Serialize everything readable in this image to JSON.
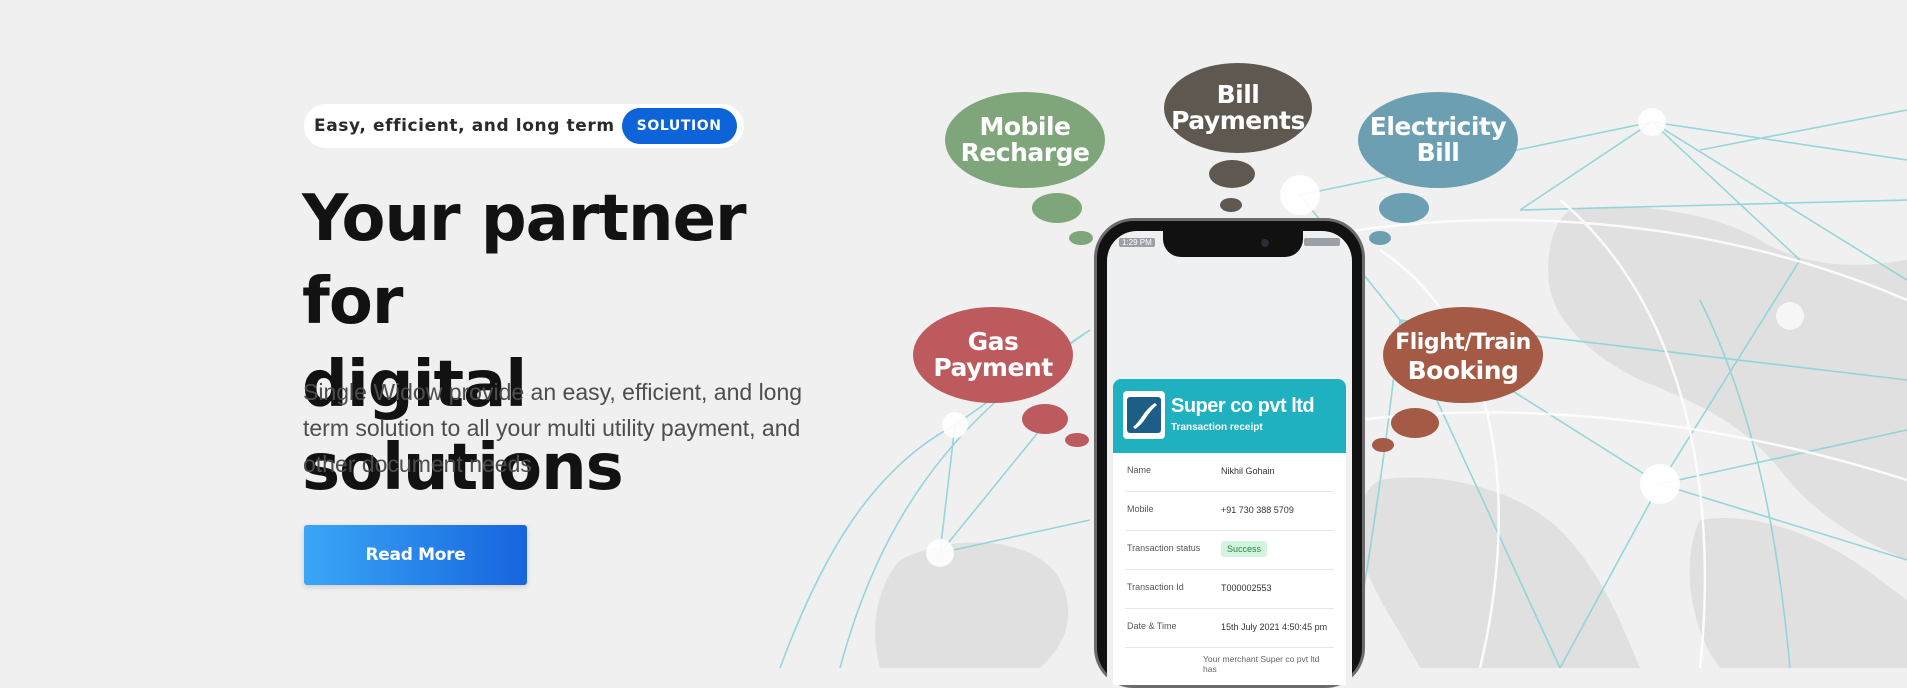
{
  "hero": {
    "tagline_text": "Easy, efficient, and long term",
    "tagline_badge": "SOLUTION",
    "title_line1": "Your partner for",
    "title_line2": "digital solutions",
    "description": "Single Widow provide an easy, efficient, and long term solution to all your multi utility payment, and other document needs",
    "read_more": "Read More"
  },
  "bubbles": [
    {
      "line1": "Mobile",
      "line2": "Recharge",
      "color": "#7fa57a"
    },
    {
      "line1": "Bill",
      "line2": "Payments",
      "color": "#5f5850"
    },
    {
      "line1": "Electricity",
      "line2": "Bill",
      "color": "#6d9fb3"
    },
    {
      "line1": "Gas",
      "line2": "Payment",
      "color": "#bd5a5e"
    },
    {
      "line1": "Flight/Train",
      "line2": "Booking",
      "color": "#a45a44"
    }
  ],
  "phone": {
    "status_time": "1:29 PM",
    "receipt": {
      "company": "Super co pvt ltd",
      "subtitle": "Transaction receipt",
      "rows": [
        {
          "label": "Name",
          "value": "Nikhil Gohain"
        },
        {
          "label": "Mobile",
          "value": "+91 730 388 5709"
        },
        {
          "label": "Transaction status",
          "value": "Success"
        },
        {
          "label": "Transaction Id",
          "value": "T000002553"
        },
        {
          "label": "Date & Time",
          "value": "15th July 2021 4:50:45 pm"
        }
      ],
      "footer_note": "Your merchant Super co pvt ltd has"
    }
  },
  "colors": {
    "accent": "#0d63d8",
    "button_gradient_start": "#3aa6f7",
    "button_gradient_end": "#1665dd",
    "receipt_header": "#1fb1bf",
    "globe_lines": "#7fd0d6"
  }
}
